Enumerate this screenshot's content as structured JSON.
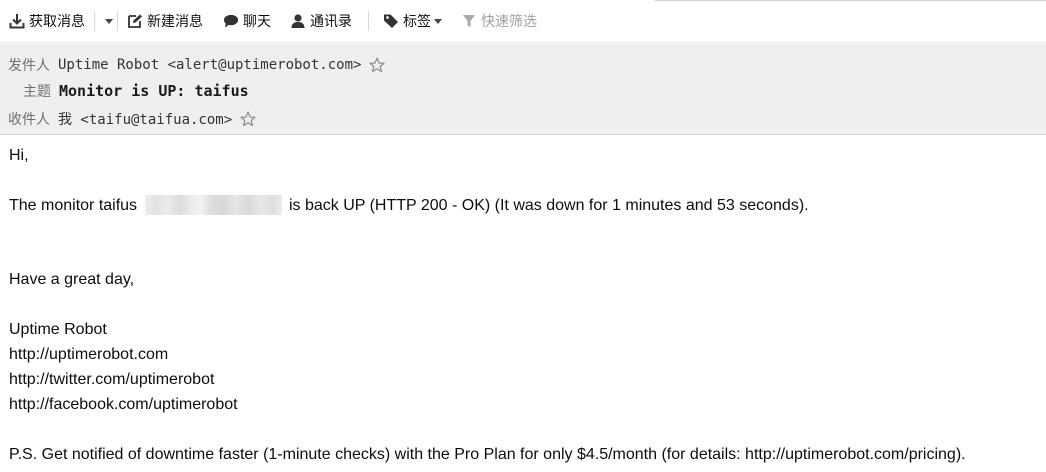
{
  "toolbar": {
    "get_messages": "获取消息",
    "new_message": "新建消息",
    "chat": "聊天",
    "address_book": "通讯录",
    "tags": "标签",
    "quick_filter": "快速筛选"
  },
  "header": {
    "from_label": "发件人",
    "from_value": "Uptime Robot <alert@uptimerobot.com>",
    "subject_label": "主题",
    "subject_value": "Monitor is UP: taifus",
    "to_label": "收件人",
    "to_value": "我 <taifu@taifua.com>"
  },
  "message": {
    "greeting": "Hi,",
    "line1_before": "The monitor taifus",
    "line1_after": "is back UP (HTTP 200 - OK) (It was down for 1 minutes and 53 seconds).",
    "closing": "Have a great day,",
    "signature_name": "Uptime Robot",
    "link1": "http://uptimerobot.com",
    "link2": "http://twitter.com/uptimerobot",
    "link3": "http://facebook.com/uptimerobot",
    "ps": "P.S. Get notified of downtime faster (1-minute checks) with the Pro Plan for only $4.5/month (for details: http://uptimerobot.com/pricing)."
  },
  "icons": {
    "get_messages": "download-icon",
    "dropdown": "caret-down-icon",
    "new_message": "pencil-icon",
    "chat": "chat-bubble-icon",
    "address_book": "person-icon",
    "tags": "tag-icon",
    "quick_filter": "funnel-icon",
    "star": "star-outline-icon"
  }
}
